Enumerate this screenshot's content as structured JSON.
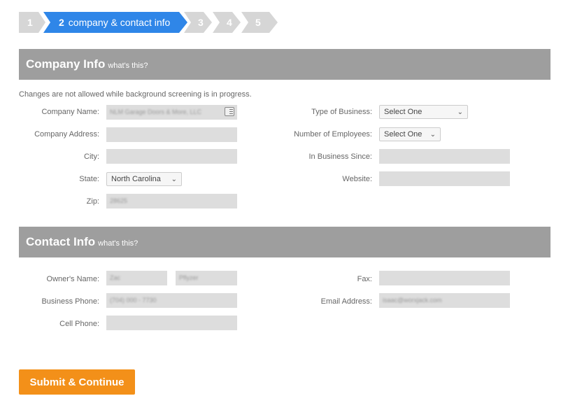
{
  "stepper": {
    "steps": [
      {
        "num": "1"
      },
      {
        "num": "2",
        "label": "company & contact info"
      },
      {
        "num": "3"
      },
      {
        "num": "4"
      },
      {
        "num": "5"
      }
    ],
    "active_color": "#2f86e8",
    "inactive_color": "#d6d6d6"
  },
  "company_section": {
    "title": "Company Info",
    "help_link": "what's this?",
    "notice": "Changes are not allowed while background screening is in progress.",
    "fields": {
      "company_name": {
        "label": "Company Name:",
        "value": "NLM Garage Doors & More, LLC"
      },
      "company_address": {
        "label": "Company Address:",
        "value": ""
      },
      "city": {
        "label": "City:",
        "value": ""
      },
      "state": {
        "label": "State:",
        "value": "North Carolina"
      },
      "zip": {
        "label": "Zip:",
        "value": "28625"
      },
      "type_of_business": {
        "label": "Type of Business:",
        "value": "Select One"
      },
      "number_of_employees": {
        "label": "Number of Employees:",
        "value": "Select One"
      },
      "in_business_since": {
        "label": "In Business Since:",
        "value": ""
      },
      "website": {
        "label": "Website:",
        "value": ""
      }
    }
  },
  "contact_section": {
    "title": "Contact Info",
    "help_link": "what's this?",
    "fields": {
      "owners_name": {
        "label": "Owner's Name:",
        "first": "Zac",
        "last": "Pflyzer"
      },
      "business_phone": {
        "label": "Business Phone:",
        "value": "(704) 000 - 7730"
      },
      "cell_phone": {
        "label": "Cell Phone:",
        "value": ""
      },
      "fax": {
        "label": "Fax:",
        "value": ""
      },
      "email": {
        "label": "Email Address:",
        "value": "isaac@worxjack.com"
      }
    }
  },
  "submit": {
    "label": "Submit & Continue",
    "color": "#f39019"
  },
  "colors": {
    "section_header": "#9e9e9e",
    "field_bg": "#dddddd"
  }
}
